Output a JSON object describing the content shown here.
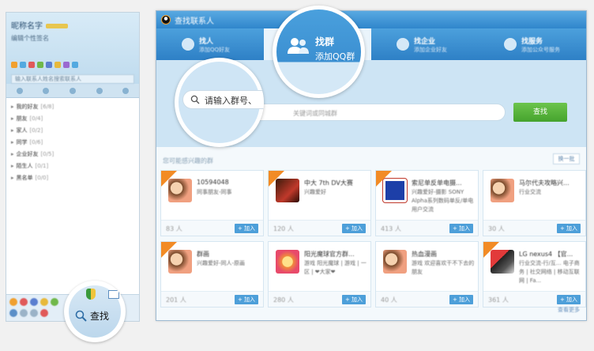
{
  "main_panel": {
    "nickname": "昵称名字",
    "signature": "编辑个性签名",
    "search_placeholder": "输入联系人姓名搜索联系人",
    "groups": [
      {
        "label": "我的好友",
        "count": "[6/8]"
      },
      {
        "label": "朋友",
        "count": "[0/4]"
      },
      {
        "label": "家人",
        "count": "[0/2]"
      },
      {
        "label": "同学",
        "count": "[0/6]"
      },
      {
        "label": "企业好友",
        "count": "[0/5]"
      },
      {
        "label": "陌生人",
        "count": "[0/1]"
      },
      {
        "label": "黑名单",
        "count": "[0/0]"
      }
    ],
    "find_label": "查找"
  },
  "find_window": {
    "title": "查找联系人",
    "tabs": [
      {
        "title": "找人",
        "subtitle": "添加QQ好友"
      },
      {
        "title": "找群",
        "subtitle": "添加QQ群"
      },
      {
        "title": "找企业",
        "subtitle": "添加企业好友"
      },
      {
        "title": "找服务",
        "subtitle": "添加公众号服务"
      }
    ],
    "search": {
      "placeholder": "请输入群号、",
      "placeholder_rest": "关键词或同城群",
      "button": "查找"
    },
    "recommend_label": "您可能感兴趣的群",
    "change_label": "换一批",
    "join_label": "+ 加入",
    "cards": [
      {
        "name": "10594048",
        "desc": "同事朋友-同事",
        "members": "83 人",
        "hot": true,
        "avatar": "people"
      },
      {
        "name": "中大 7th DV大赛",
        "desc": "兴趣爱好",
        "members": "120 人",
        "hot": true,
        "avatar": "photo-dark"
      },
      {
        "name": "索尼单反单电摄...",
        "desc": "兴趣爱好-摄影  SONY Alpha系列数码单反/单电用户交流",
        "members": "413 人",
        "hot": true,
        "avatar": "zeiss"
      },
      {
        "name": "马尔代夫攻略兴...",
        "desc": "行业交流",
        "members": "30 人",
        "hot": false,
        "avatar": "people"
      },
      {
        "name": "群画",
        "desc": "兴趣爱好-同人-原画",
        "members": "201 人",
        "hot": true,
        "avatar": "people"
      },
      {
        "name": "阳光魔球官方群...",
        "desc": "游戏  阳光魔球 | 游戏 | 一区 | ❤大家❤",
        "members": "280 人",
        "hot": false,
        "avatar": "cartoon"
      },
      {
        "name": "热血漫画",
        "desc": "游戏  欢迎喜欢干不下去的朋友",
        "members": "40 人",
        "hot": false,
        "avatar": "people"
      },
      {
        "name": "LG nexus4 【官...",
        "desc": "行业交流-行/互...  电子商务 | 社交网络 | 移动互联网 | Fa...",
        "members": "361 人",
        "hot": true,
        "avatar": "device"
      }
    ],
    "bottom_link": "查看更多"
  }
}
